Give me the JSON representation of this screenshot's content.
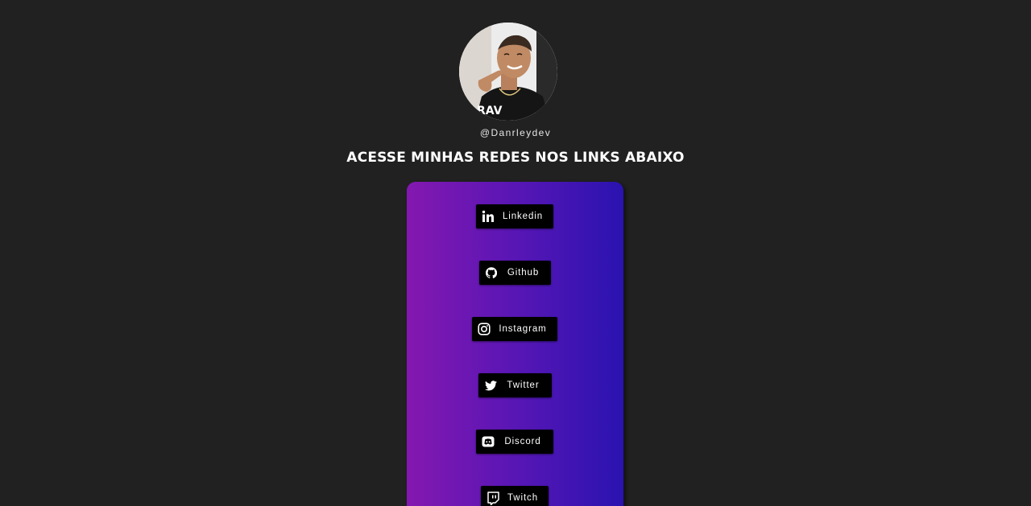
{
  "profile": {
    "handle": "@Danrleydev",
    "avatar_alt": "profile photo"
  },
  "headline": "ACESSE MINHAS REDES NOS LINKS ABAIXO",
  "colors": {
    "background": "#212121",
    "card_gradient_start": "#8418b0",
    "card_gradient_end": "#2a13b0",
    "button_bg": "#000000",
    "button_text": "#ffffff"
  },
  "links": [
    {
      "label": "Linkedin",
      "icon": "linkedin-icon"
    },
    {
      "label": "Github",
      "icon": "github-icon"
    },
    {
      "label": "Instagram",
      "icon": "instagram-icon"
    },
    {
      "label": "Twitter",
      "icon": "twitter-icon"
    },
    {
      "label": "Discord",
      "icon": "discord-icon"
    },
    {
      "label": "Twitch",
      "icon": "twitch-icon"
    }
  ]
}
